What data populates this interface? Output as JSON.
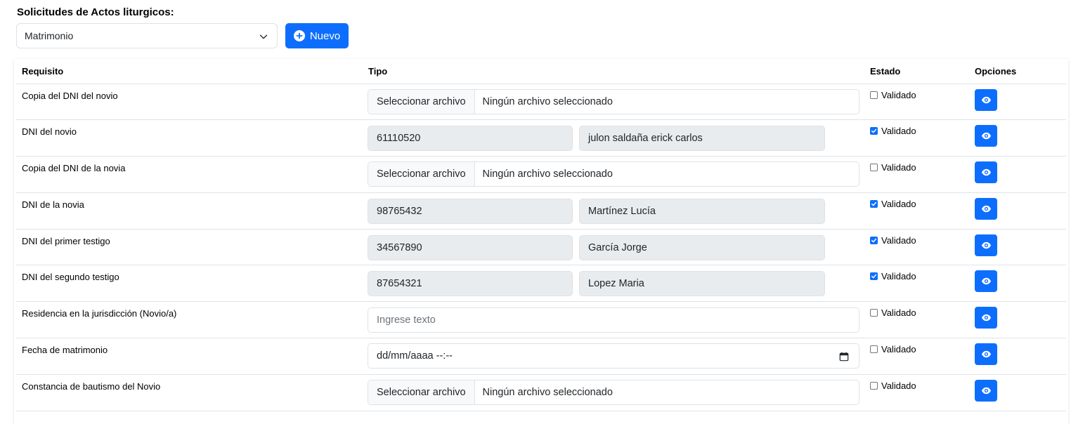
{
  "page": {
    "title": "Solicitudes de Actos liturgicos:"
  },
  "toolbar": {
    "select_value": "Matrimonio",
    "new_label": "Nuevo"
  },
  "colors": {
    "primary": "#0d6efd",
    "readonly_bg": "#e9ecef",
    "border": "#dee2e6"
  },
  "table": {
    "headers": {
      "requisito": "Requisito",
      "tipo": "Tipo",
      "estado": "Estado",
      "opciones": "Opciones"
    },
    "rows": [
      {
        "requisito": "Copia del DNI del novio",
        "type": "file",
        "file_button": "Seleccionar archivo",
        "file_text": "Ningún archivo seleccionado",
        "validated": false,
        "estado_label": "Validado",
        "action_icon": "eye-icon"
      },
      {
        "requisito": "DNI del novio",
        "type": "dni",
        "dni": "61110520",
        "name": "julon saldaña erick carlos",
        "validated": true,
        "estado_label": "Validado",
        "action_icon": "eye-icon"
      },
      {
        "requisito": "Copia del DNI de la novia",
        "type": "file",
        "file_button": "Seleccionar archivo",
        "file_text": "Ningún archivo seleccionado",
        "validated": false,
        "estado_label": "Validado",
        "action_icon": "eye-icon"
      },
      {
        "requisito": "DNI de la novia",
        "type": "dni",
        "dni": "98765432",
        "name": "Martínez Lucía",
        "validated": true,
        "estado_label": "Validado",
        "action_icon": "eye-icon"
      },
      {
        "requisito": "DNI del primer testigo",
        "type": "dni",
        "dni": "34567890",
        "name": "García Jorge",
        "validated": true,
        "estado_label": "Validado",
        "action_icon": "eye-icon"
      },
      {
        "requisito": "DNI del segundo testigo",
        "type": "dni",
        "dni": "87654321",
        "name": "Lopez Maria",
        "validated": true,
        "estado_label": "Validado",
        "action_icon": "eye-icon"
      },
      {
        "requisito": "Residencia en la jurisdicción (Novio/a)",
        "type": "text",
        "value": "",
        "placeholder": "Ingrese texto",
        "validated": false,
        "estado_label": "Validado",
        "action_icon": "eye-icon"
      },
      {
        "requisito": "Fecha de matrimonio",
        "type": "date",
        "value": "dd/mm/aaaa --:--",
        "validated": false,
        "estado_label": "Validado",
        "action_icon": "eye-icon"
      },
      {
        "requisito": "Constancia de bautismo del Novio",
        "type": "file",
        "file_button": "Seleccionar archivo",
        "file_text": "Ningún archivo seleccionado",
        "validated": false,
        "estado_label": "Validado",
        "action_icon": "eye-icon"
      }
    ]
  }
}
